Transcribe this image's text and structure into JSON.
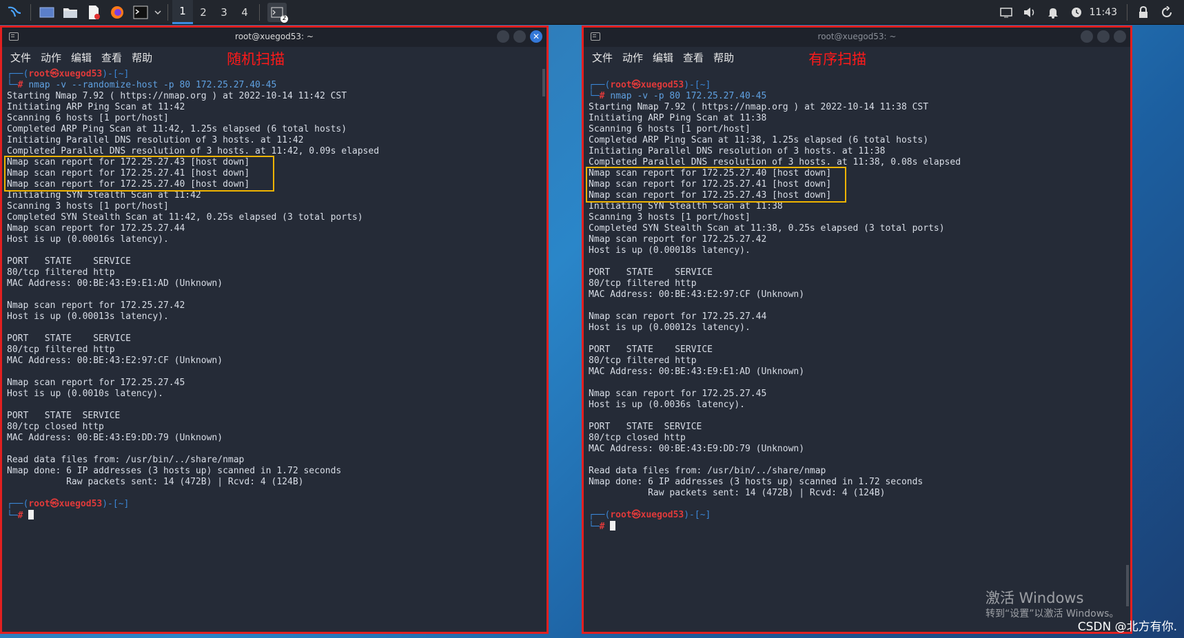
{
  "taskbar": {
    "workspaces": [
      "1",
      "2",
      "3",
      "4"
    ],
    "terminal_badge": "2",
    "clock": "11:43"
  },
  "left_window": {
    "title": "root@xuegod53: ~",
    "menu": [
      "文件",
      "动作",
      "编辑",
      "查看",
      "帮助"
    ],
    "annotation": "随机扫描",
    "prompt_user": "root㉿xuegod53",
    "prompt_dir": "~",
    "command": "nmap -v --randomize-host -p 80 172.25.27.40-45",
    "output": [
      "Starting Nmap 7.92 ( https://nmap.org ) at 2022-10-14 11:42 CST",
      "Initiating ARP Ping Scan at 11:42",
      "Scanning 6 hosts [1 port/host]",
      "Completed ARP Ping Scan at 11:42, 1.25s elapsed (6 total hosts)",
      "Initiating Parallel DNS resolution of 3 hosts. at 11:42",
      "Completed Parallel DNS resolution of 3 hosts. at 11:42, 0.09s elapsed",
      "Nmap scan report for 172.25.27.43 [host down]",
      "Nmap scan report for 172.25.27.41 [host down]",
      "Nmap scan report for 172.25.27.40 [host down]",
      "Initiating SYN Stealth Scan at 11:42",
      "Scanning 3 hosts [1 port/host]",
      "Completed SYN Stealth Scan at 11:42, 0.25s elapsed (3 total ports)",
      "Nmap scan report for 172.25.27.44",
      "Host is up (0.00016s latency).",
      "",
      "PORT   STATE    SERVICE",
      "80/tcp filtered http",
      "MAC Address: 00:BE:43:E9:E1:AD (Unknown)",
      "",
      "Nmap scan report for 172.25.27.42",
      "Host is up (0.00013s latency).",
      "",
      "PORT   STATE    SERVICE",
      "80/tcp filtered http",
      "MAC Address: 00:BE:43:E2:97:CF (Unknown)",
      "",
      "Nmap scan report for 172.25.27.45",
      "Host is up (0.0010s latency).",
      "",
      "PORT   STATE  SERVICE",
      "80/tcp closed http",
      "MAC Address: 00:BE:43:E9:DD:79 (Unknown)",
      "",
      "Read data files from: /usr/bin/../share/nmap",
      "Nmap done: 6 IP addresses (3 hosts up) scanned in 1.72 seconds",
      "           Raw packets sent: 14 (472B) | Rcvd: 4 (124B)"
    ]
  },
  "right_window": {
    "title": "root@xuegod53: ~",
    "menu": [
      "文件",
      "动作",
      "编辑",
      "查看",
      "帮助"
    ],
    "annotation": "有序扫描",
    "prompt_user": "root㉿xuegod53",
    "prompt_dir": "~",
    "command": "nmap -v -p 80 172.25.27.40-45",
    "output": [
      "Starting Nmap 7.92 ( https://nmap.org ) at 2022-10-14 11:38 CST",
      "Initiating ARP Ping Scan at 11:38",
      "Scanning 6 hosts [1 port/host]",
      "Completed ARP Ping Scan at 11:38, 1.25s elapsed (6 total hosts)",
      "Initiating Parallel DNS resolution of 3 hosts. at 11:38",
      "Completed Parallel DNS resolution of 3 hosts. at 11:38, 0.08s elapsed",
      "Nmap scan report for 172.25.27.40 [host down]",
      "Nmap scan report for 172.25.27.41 [host down]",
      "Nmap scan report for 172.25.27.43 [host down]",
      "Initiating SYN Stealth Scan at 11:38",
      "Scanning 3 hosts [1 port/host]",
      "Completed SYN Stealth Scan at 11:38, 0.25s elapsed (3 total ports)",
      "Nmap scan report for 172.25.27.42",
      "Host is up (0.00018s latency).",
      "",
      "PORT   STATE    SERVICE",
      "80/tcp filtered http",
      "MAC Address: 00:BE:43:E2:97:CF (Unknown)",
      "",
      "Nmap scan report for 172.25.27.44",
      "Host is up (0.00012s latency).",
      "",
      "PORT   STATE    SERVICE",
      "80/tcp filtered http",
      "MAC Address: 00:BE:43:E9:E1:AD (Unknown)",
      "",
      "Nmap scan report for 172.25.27.45",
      "Host is up (0.0036s latency).",
      "",
      "PORT   STATE  SERVICE",
      "80/tcp closed http",
      "MAC Address: 00:BE:43:E9:DD:79 (Unknown)",
      "",
      "Read data files from: /usr/bin/../share/nmap",
      "Nmap done: 6 IP addresses (3 hosts up) scanned in 1.72 seconds",
      "           Raw packets sent: 14 (472B) | Rcvd: 4 (124B)"
    ]
  },
  "desktop": {
    "activation_title": "激活 Windows",
    "activation_sub": "转到“设置”以激活 Windows。",
    "credit": "CSDN @北方有你."
  },
  "colors": {
    "terminal_bg": "#252b37",
    "annotation_red": "#ff1a1a",
    "highlight_yellow": "#f0b400",
    "prompt_blue": "#3a86d6",
    "prompt_red": "#e03a3a"
  }
}
